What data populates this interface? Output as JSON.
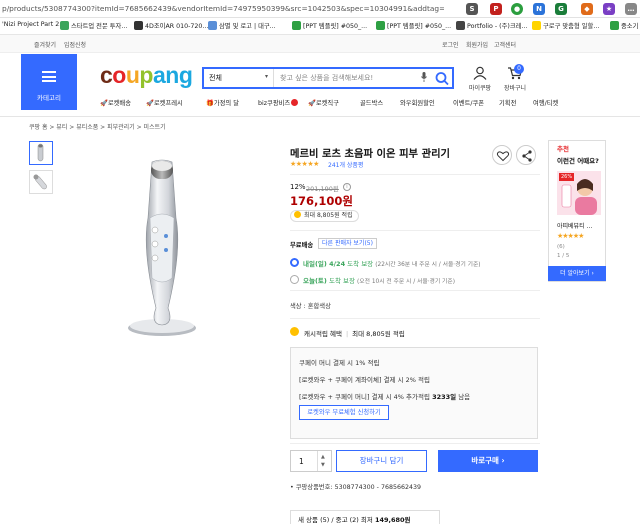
{
  "browser": {
    "url": "p/products/5308774300?itemId=7685662439&vendorItemId=74975950399&src=1042503&spec=10304991&addtag=400&ctag=530...",
    "bookmarks": [
      "'Nizi Project Part 2...",
      "스타트업 전문 투자...",
      "4D조이AR 010-720...",
      "삼별 및 로고 | 대구...",
      "[PPT 템플릿] #050_...",
      "[PPT 템플릿] #050_...",
      "Portfolio - (주)크레...",
      "구로구 맞춤형 일할...",
      "중소기"
    ]
  },
  "toplinks": {
    "left": [
      "즐겨찾기",
      "입점신청"
    ],
    "right": [
      "로그인",
      "회원가입",
      "고객센터"
    ]
  },
  "header": {
    "menu_label": "카테고리",
    "logo": {
      "c1": "c",
      "c2": "o",
      "c3": "u",
      "c4": "p",
      "c5": "a",
      "c6": "n",
      "c7": "g"
    },
    "search_category": "전체",
    "search_placeholder": "찾고 싶은 상품을 검색해보세요!",
    "mypage": "마이쿠팡",
    "cart": "장바구니",
    "cart_count": "0",
    "colors": {
      "brand": "#346aff",
      "price": "#ae0000"
    }
  },
  "nav": [
    "로켓배송",
    "로켓프레시",
    "가정의 달",
    "biz쿠팡비즈",
    "로켓직구",
    "골드박스",
    "와우회원할인",
    "이벤트/쿠폰",
    "기획전",
    "여행/티켓"
  ],
  "breadcrumb": "쿠팡 홈  >  뷰티  >  뷰티소품  >  피부관리기  >  미스트기",
  "product": {
    "title": "메르비 로츠 초음파 이온 피부 관리기",
    "stars": "★★★★★",
    "reviews": "241개 상품평",
    "discount": "12%",
    "original_price": "201,190원",
    "price": "176,100원",
    "point_badge": "최대 8,805원 적립",
    "shipping_label": "무료배송",
    "other_sellers": "다른 판매자 보기(5)",
    "ship_option1_date": "내일(일) 4/24",
    "ship_option1_arrival": "도착 보장",
    "ship_option1_note": "(22시간 36분 내 주문 시 / 서울⋅경기 기준)",
    "ship_option2_date": "오늘(토)",
    "ship_option2_arrival": "도착 보장",
    "ship_option2_note": "(오전 10시 전 주문 시 / 서울⋅경기 기준)",
    "option": "색상 : 혼합색상",
    "cash_label": "캐시적립 혜택",
    "cash_value": "최대 8,805원 적립",
    "card_lines": [
      "쿠페이 머니 결제 시 1% 적립",
      "[로켓와우 + 쿠페이 계좌이체] 결제 시 2% 적립",
      "[로켓와우 + 쿠페이 머니] 결제 시 4% 추가적립"
    ],
    "card_remaining_days": "3233일",
    "card_remaining_suffix": " 남음",
    "apply_button": "로켓와우 무료체험 신청하기",
    "quantity": "1",
    "add_to_cart": "장바구니 담기",
    "buy_now": "바로구매 ›",
    "product_number": "쿠팡상품번호: 5308774300 - 7685662439",
    "new_used": "새 상품 (5) / 중고 (2) 최저 ",
    "new_used_price": "149,680원"
  },
  "side": {
    "title_red": "추천",
    "title": "이런건 어때요?",
    "badge": "26%",
    "item_name": "아띠베뷰티 ...",
    "item_stars": "★★★★★",
    "item_count": "(6)",
    "page": "1 / 5",
    "more": "더 알아보기 ›"
  }
}
